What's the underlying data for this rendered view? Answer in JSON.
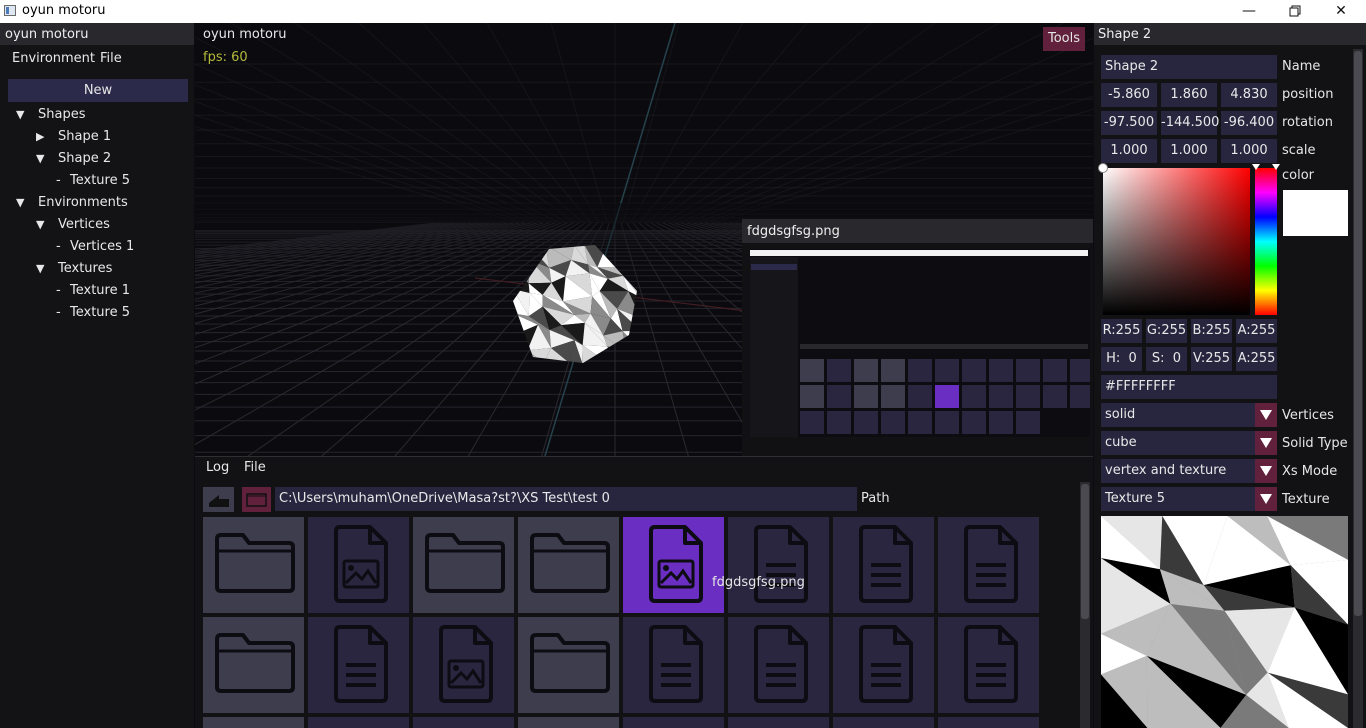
{
  "window": {
    "title": "oyun motoru",
    "controls": [
      "minimize",
      "maximize",
      "close"
    ]
  },
  "left_panel": {
    "title": "oyun motoru",
    "menu": [
      "Environment",
      "File"
    ],
    "new_button": "New",
    "tree": [
      {
        "label": "Shapes",
        "prefix": "▼",
        "indent": 0
      },
      {
        "label": "Shape 1",
        "prefix": "▶",
        "indent": 1
      },
      {
        "label": "Shape 2",
        "prefix": "▼",
        "indent": 1
      },
      {
        "label": "Texture 5",
        "prefix": "-",
        "indent": 2
      },
      {
        "label": "Environments",
        "prefix": "▼",
        "indent": 0
      },
      {
        "label": "Vertices",
        "prefix": "▼",
        "indent": 1
      },
      {
        "label": "Vertices 1",
        "prefix": "-",
        "indent": 2
      },
      {
        "label": "Textures",
        "prefix": "▼",
        "indent": 1
      },
      {
        "label": "Texture 1",
        "prefix": "-",
        "indent": 2
      },
      {
        "label": "Texture 5",
        "prefix": "-",
        "indent": 2
      }
    ]
  },
  "viewport": {
    "title": "oyun motoru",
    "fps": "fps: 60",
    "tools_button": "Tools"
  },
  "preview": {
    "title": "fdgdsgfsg.png"
  },
  "file_browser": {
    "menu": [
      "Log",
      "File"
    ],
    "path_value": "C:\\Users\\muham\\OneDrive\\Masa?st?\\XS Test\\test 0",
    "path_label": "Path",
    "hover_label": "fdgdsgfsg.png",
    "rows": [
      [
        "folder",
        "image",
        "folder",
        "folder",
        "image-selected",
        "doc",
        "doc",
        "doc"
      ],
      [
        "folder",
        "doc",
        "image",
        "folder",
        "doc",
        "doc",
        "doc",
        "doc"
      ]
    ]
  },
  "inspector": {
    "title": "Shape 2",
    "name_value": "Shape 2",
    "name_label": "Name",
    "position": [
      "-5.860",
      "1.860",
      "4.830"
    ],
    "position_label": "position",
    "rotation": [
      "-97.500",
      "-144.500",
      "-96.400"
    ],
    "rotation_label": "rotation",
    "scale": [
      "1.000",
      "1.000",
      "1.000"
    ],
    "scale_label": "scale",
    "color_label": "color",
    "rgba": [
      "R:255",
      "G:255",
      "B:255",
      "A:255"
    ],
    "hsva": [
      "H:  0",
      "S:  0",
      "V:255",
      "A:255"
    ],
    "hex": "#FFFFFFFF",
    "vertices_value": "solid",
    "vertices_label": "Vertices",
    "solid_type_value": "cube",
    "solid_type_label": "Solid Type",
    "xs_mode_value": "vertex and texture",
    "xs_mode_label": "Xs Mode",
    "texture_value": "Texture 5",
    "texture_label": "Texture"
  },
  "colors": {
    "accent_purple": "#6a2ec2",
    "accent_red": "#61203b",
    "field_navy": "#28263f",
    "fps_text": "#b5b93a",
    "selected_color": "#ffffff"
  }
}
